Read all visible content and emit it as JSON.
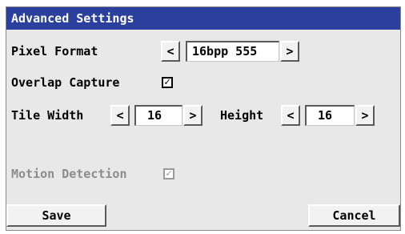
{
  "window": {
    "title": "Advanced Settings"
  },
  "pixel_format": {
    "label": "Pixel Format",
    "value": "16bpp 555",
    "prev": "<",
    "next": ">"
  },
  "overlap_capture": {
    "label": "Overlap Capture",
    "check": "✓",
    "checked": true
  },
  "tile": {
    "width_label": "Tile Width",
    "width_value": "16",
    "width_prev": "<",
    "width_next": ">",
    "height_label": "Height",
    "height_value": "16",
    "height_prev": "<",
    "height_next": ">"
  },
  "motion_detection": {
    "label": "Motion Detection",
    "check": "✓",
    "checked": true,
    "enabled": false
  },
  "footer": {
    "save_label": "Save",
    "cancel_label": "Cancel"
  },
  "colors": {
    "titlebar": "#2b3f9e",
    "title_text": "#ffffff",
    "panel": "#e8e8e8",
    "disabled_text": "#8c8c8c"
  }
}
